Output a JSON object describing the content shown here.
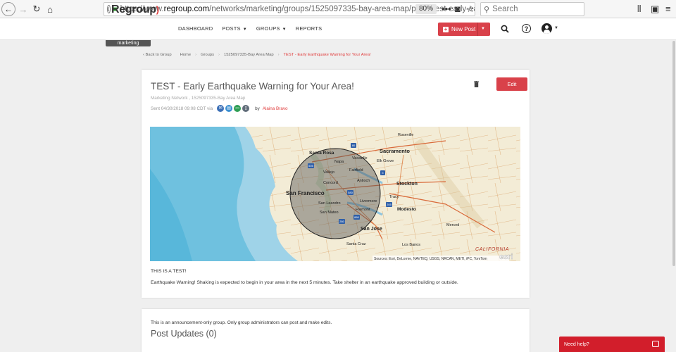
{
  "browser": {
    "url_prefix": "https://www.",
    "url_domain": "regroup.com",
    "url_path": "/networks/marketing/groups/1525097335-bay-area-map/posts/test-early-ea",
    "zoom": "80%",
    "search_placeholder": "Search"
  },
  "header": {
    "logo": "Regroup",
    "network_label": "marketing",
    "nav": [
      {
        "label": "DASHBOARD"
      },
      {
        "label": "POSTS"
      },
      {
        "label": "GROUPS"
      },
      {
        "label": "REPORTS"
      }
    ],
    "new_post_label": "New Post"
  },
  "breadcrumb": {
    "back": "Back to Group",
    "items": [
      "Home",
      "Groups",
      "1525097335-Bay Area Map"
    ],
    "current": "TEST - Early Earthquake Warning for Your Area!"
  },
  "post": {
    "title": "TEST - Early Earthquake Warning for Your Area!",
    "meta": "Marketing Network , 1525097335-Bay Area Map",
    "sent": "Sent 04/30/2018 09:08 CDT via",
    "author_prefix": "by",
    "author": "Alaina Bravo",
    "edit_label": "Edit",
    "line1": "THIS IS A TEST!",
    "line2": "Earthquake Warning! Shaking is expected to begin in your area in the next 5 minutes. Take shelter in an earthquake approved building or outside.",
    "channels": [
      {
        "icon": "email-icon",
        "color": "#3b6fb6"
      },
      {
        "icon": "sms-icon",
        "color": "#3b8fd1"
      },
      {
        "icon": "desktop-icon",
        "color": "#2f9e55"
      },
      {
        "icon": "phone-icon",
        "color": "#616d7a"
      }
    ]
  },
  "map": {
    "cities": [
      "Santa Rosa",
      "Sacramento",
      "Roseville",
      "Napa",
      "Vacaville",
      "Elk Grove",
      "Vallejo",
      "Fairfield",
      "Concord",
      "Antioch",
      "Stockton",
      "San Francisco",
      "Tracy",
      "San Leandro",
      "Livermore",
      "Modesto",
      "San Mateo",
      "Fremont",
      "San Jose",
      "Merced",
      "Santa Cruz",
      "Los Banos",
      "CALIFORNIA"
    ],
    "attribution": "Sources: Esri, DeLorme, NAVTEQ, USGS, NRCAN, METI, iPC, TomTom",
    "esri_logo": "esri",
    "interstates": [
      "80",
      "505",
      "5",
      "580",
      "205",
      "880",
      "280"
    ]
  },
  "updates": {
    "announcement": "This is an announcement-only group. Only group administrators can post and make edits.",
    "title": "Post Updates (0)"
  },
  "help_widget": "Need help?"
}
